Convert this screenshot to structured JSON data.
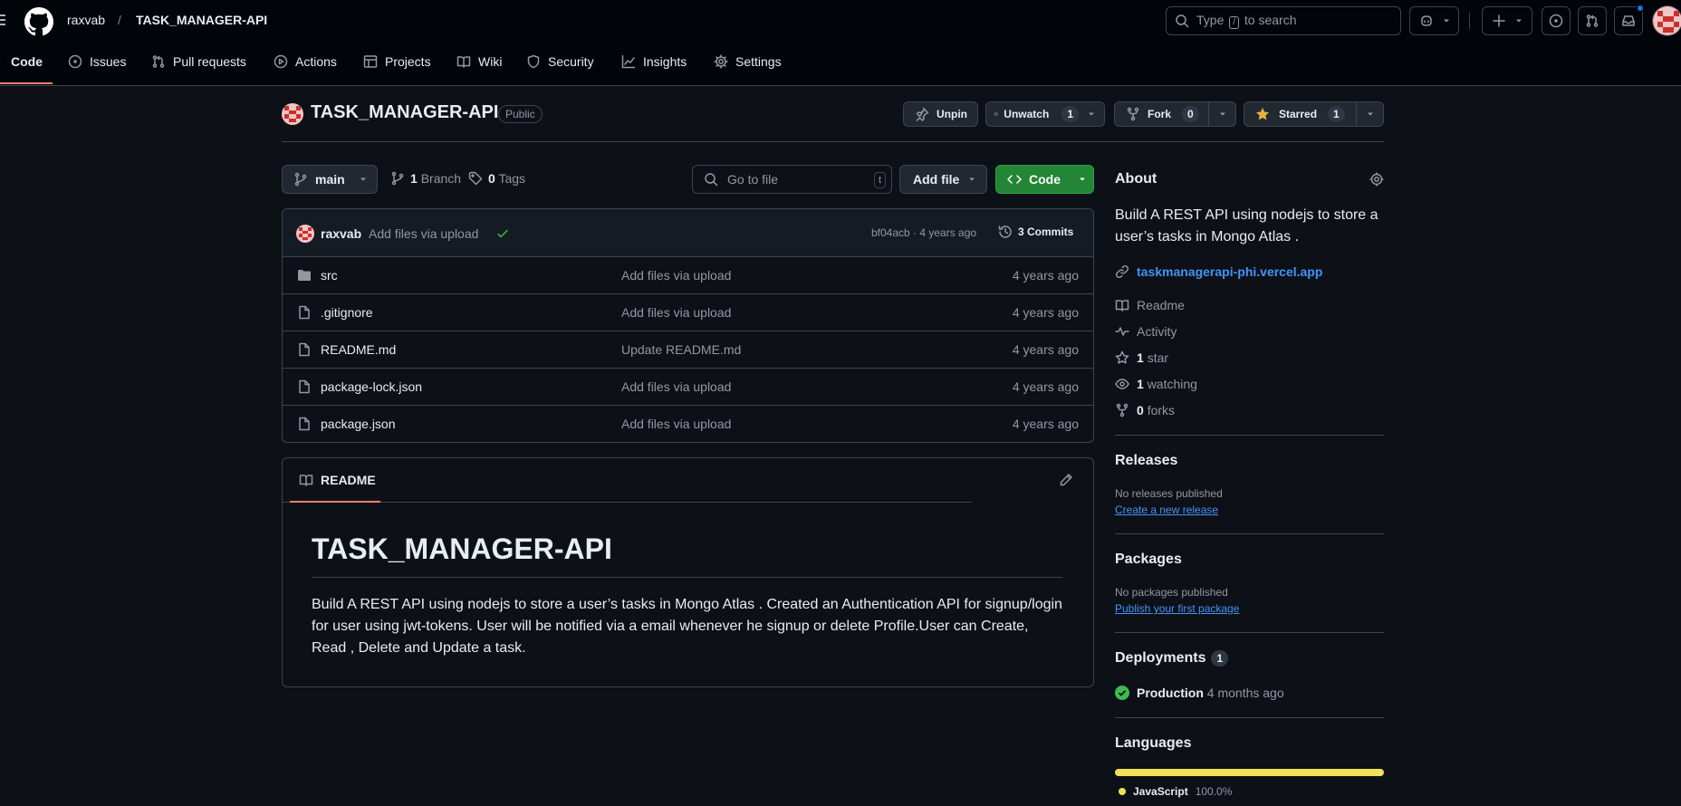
{
  "header": {
    "owner": "raxvab",
    "separator": "/",
    "repo": "TASK_MANAGER-API",
    "search_prefix": "Type",
    "search_key": "/",
    "search_suffix": "to search"
  },
  "nav": {
    "code": "Code",
    "issues": "Issues",
    "pulls": "Pull requests",
    "actions": "Actions",
    "projects": "Projects",
    "wiki": "Wiki",
    "security": "Security",
    "insights": "Insights",
    "settings": "Settings"
  },
  "repo": {
    "title": "TASK_MANAGER-API",
    "visibility": "Public",
    "unpin": "Unpin",
    "unwatch": "Unwatch",
    "watch_count": "1",
    "fork": "Fork",
    "fork_count": "0",
    "starred": "Starred",
    "star_count": "1"
  },
  "toolbar": {
    "branch": "main",
    "branch_count": "1",
    "branch_label": "Branch",
    "tag_count": "0",
    "tag_label": "Tags",
    "goto_placeholder": "Go to file",
    "goto_key": "t",
    "add_file": "Add file",
    "code": "Code"
  },
  "commit": {
    "author": "raxvab",
    "message": "Add files via upload",
    "hash_time": "bf04acb · 4 years ago",
    "commits": "3 Commits"
  },
  "files": [
    {
      "name": "src",
      "type": "folder",
      "message": "Add files via upload",
      "date": "4 years ago"
    },
    {
      "name": ".gitignore",
      "type": "file",
      "message": "Add files via upload",
      "date": "4 years ago"
    },
    {
      "name": "README.md",
      "type": "file",
      "message": "Update README.md",
      "date": "4 years ago"
    },
    {
      "name": "package-lock.json",
      "type": "file",
      "message": "Add files via upload",
      "date": "4 years ago"
    },
    {
      "name": "package.json",
      "type": "file",
      "message": "Add files via upload",
      "date": "4 years ago"
    }
  ],
  "readme": {
    "tab": "README",
    "heading": "TASK_MANAGER-API",
    "body": "Build A REST API using nodejs to store a user’s tasks in Mongo Atlas . Created an Authentication API for signup/login for user using jwt-tokens. User will be notified via a email whenever he signup or delete Profile.User can Create, Read , Delete and Update a task."
  },
  "about": {
    "heading": "About",
    "description": "Build A REST API using nodejs to store a user’s tasks in Mongo Atlas .",
    "link": "taskmanagerapi-phi.vercel.app",
    "readme": "Readme",
    "activity": "Activity",
    "stars_count": "1",
    "stars_label": "star",
    "watching_count": "1",
    "watching_label": "watching",
    "forks_count": "0",
    "forks_label": "forks"
  },
  "releases": {
    "heading": "Releases",
    "empty": "No releases published",
    "link": "Create a new release"
  },
  "packages": {
    "heading": "Packages",
    "empty": "No packages published",
    "link": "Publish your first package"
  },
  "deployments": {
    "heading": "Deployments",
    "count": "1",
    "env": "Production",
    "time": "4 months ago"
  },
  "languages": {
    "heading": "Languages",
    "items": [
      {
        "name": "JavaScript",
        "percent": "100.0%",
        "color": "#f1e05a"
      }
    ]
  },
  "colors": {
    "accent": "#4493f8",
    "green": "#238636",
    "tab_underline": "#f78166"
  }
}
